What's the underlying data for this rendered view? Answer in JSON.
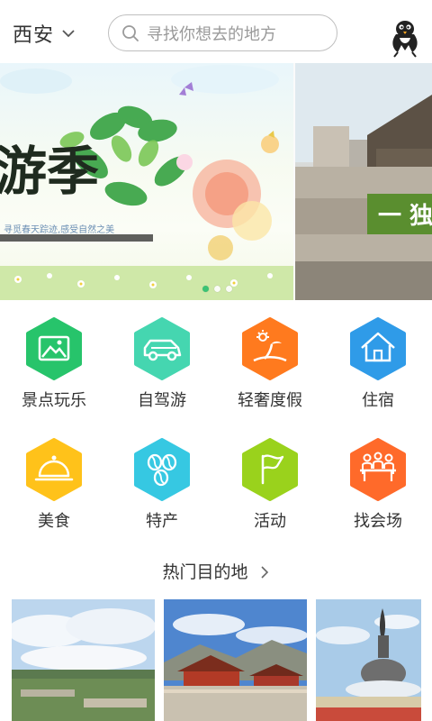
{
  "header": {
    "city": "西安",
    "search_placeholder": "寻找你想去的地方"
  },
  "banner": {
    "slide1_title": "游季",
    "slide1_caption": "寻觅春天踪迹,感受自然之美",
    "slide2_text": "一 独",
    "active_dot": 0,
    "dot_count": 3
  },
  "categories": [
    {
      "label": "景点玩乐",
      "icon": "mountain-photo-icon",
      "color": "#27c46b"
    },
    {
      "label": "自驾游",
      "icon": "car-icon",
      "color": "#45d6b0"
    },
    {
      "label": "轻奢度假",
      "icon": "beach-palm-icon",
      "color": "#ff7a1e"
    },
    {
      "label": "住宿",
      "icon": "house-icon",
      "color": "#2f9be8"
    },
    {
      "label": "美食",
      "icon": "food-cloche-icon",
      "color": "#ffc21a"
    },
    {
      "label": "特产",
      "icon": "coffee-beans-icon",
      "color": "#36c8e2"
    },
    {
      "label": "活动",
      "icon": "flag-icon",
      "color": "#9ad21c"
    },
    {
      "label": "找会场",
      "icon": "meeting-people-icon",
      "color": "#ff6a2a"
    }
  ],
  "hot": {
    "title": "热门目的地"
  },
  "thumbnails": [
    {
      "name": "landscape-thumb"
    },
    {
      "name": "temple-thumb"
    },
    {
      "name": "statue-thumb"
    }
  ]
}
